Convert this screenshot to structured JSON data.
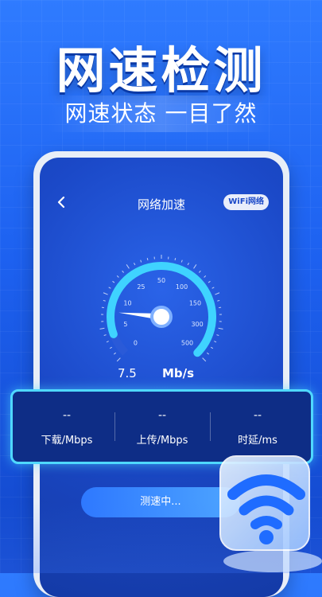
{
  "promo": {
    "headline": "网速检测",
    "subline": "网速状态 一目了然"
  },
  "app": {
    "title": "网络加速",
    "network_badge": "WiFi网络"
  },
  "gauge": {
    "ticks": [
      "0",
      "5",
      "10",
      "25",
      "50",
      "100",
      "150",
      "300",
      "500"
    ],
    "current_value": "7.5",
    "unit": "Mb/s",
    "needle_value": 7.5
  },
  "stats": [
    {
      "value": "--",
      "label": "下载/Mbps"
    },
    {
      "value": "--",
      "label": "上传/Mbps"
    },
    {
      "value": "--",
      "label": "时延/ms"
    }
  ],
  "action": {
    "label": "测速中..."
  },
  "colors": {
    "accent": "#4fd8ff",
    "primary": "#1b49c8"
  }
}
